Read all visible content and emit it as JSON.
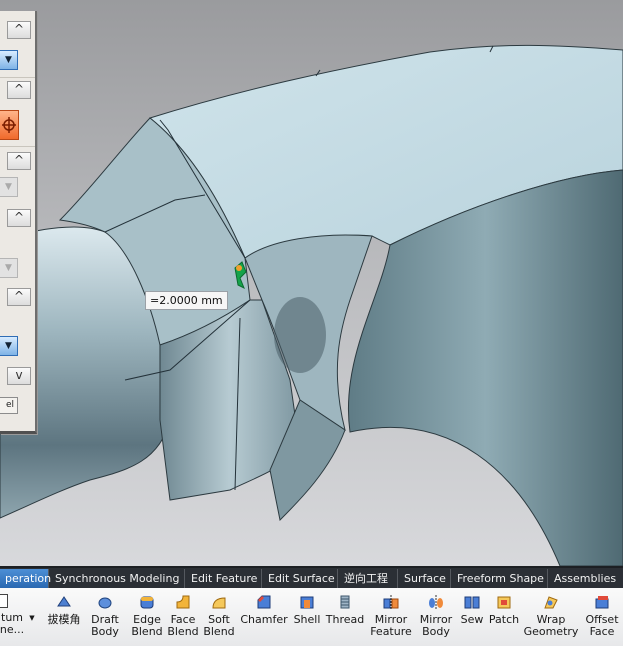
{
  "viewport": {
    "dimension_value": "=2.0000 mm"
  },
  "dialog": {
    "cancel_label": "el",
    "arrow_up": "^",
    "arrow_down": "v",
    "drop_glyph": "▼"
  },
  "tabs": [
    {
      "label": "peration",
      "active": true
    },
    {
      "label": "Synchronous Modeling",
      "active": false
    },
    {
      "label": "Edit Feature",
      "active": false
    },
    {
      "label": "Edit Surface",
      "active": false
    },
    {
      "label": "逆向工程",
      "active": false
    },
    {
      "label": "Surface",
      "active": false
    },
    {
      "label": "Freeform Shape",
      "active": false
    },
    {
      "label": "Assemblies",
      "active": false
    }
  ],
  "ribbon": {
    "datum_plane": "tum\nne...",
    "commands": [
      {
        "label": "拔模角",
        "icon": "draft-angle-icon"
      },
      {
        "label": "Draft\nBody",
        "icon": "draft-body-icon"
      },
      {
        "label": "Edge\nBlend",
        "icon": "edge-blend-icon"
      },
      {
        "label": "Face\nBlend",
        "icon": "face-blend-icon"
      },
      {
        "label": "Soft\nBlend",
        "icon": "soft-blend-icon"
      },
      {
        "label": "Chamfer",
        "icon": "chamfer-icon"
      },
      {
        "label": "Shell",
        "icon": "shell-icon"
      },
      {
        "label": "Thread",
        "icon": "thread-icon"
      },
      {
        "label": "Mirror\nFeature",
        "icon": "mirror-feature-icon"
      },
      {
        "label": "Mirror\nBody",
        "icon": "mirror-body-icon"
      },
      {
        "label": "Sew",
        "icon": "sew-icon"
      },
      {
        "label": "Patch",
        "icon": "patch-icon"
      },
      {
        "label": "Wrap\nGeometry",
        "icon": "wrap-geometry-icon"
      },
      {
        "label": "Offset\nFace",
        "icon": "offset-face-icon"
      }
    ]
  }
}
